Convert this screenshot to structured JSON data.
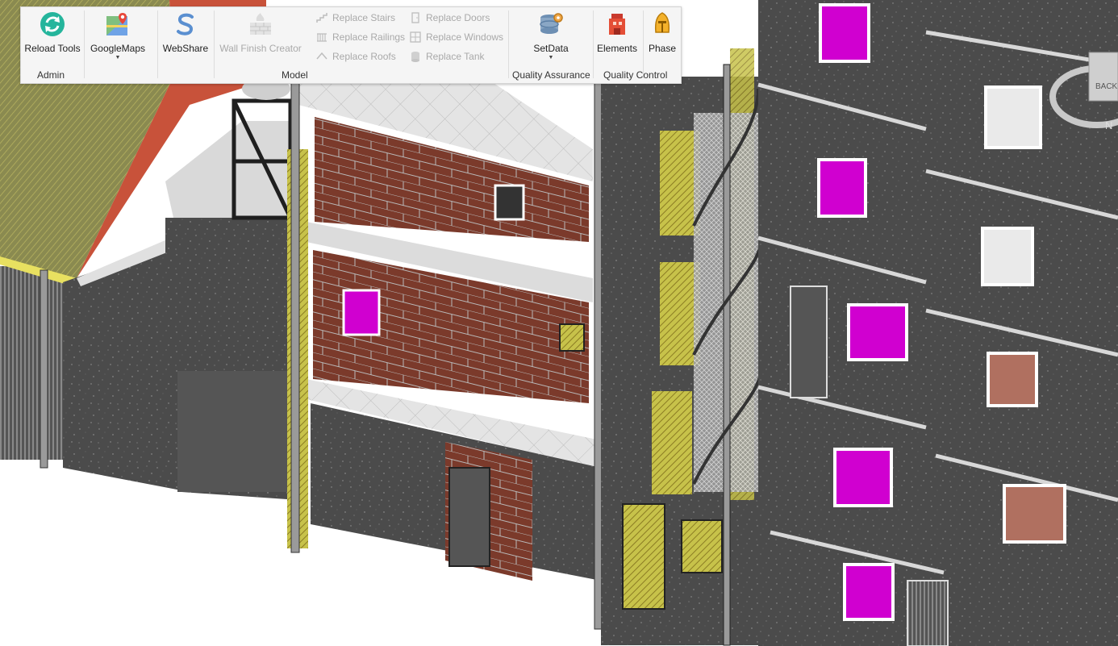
{
  "ribbon": {
    "admin": {
      "label": "Admin",
      "reload_tools": "Reload Tools"
    },
    "googlemaps": "GoogleMaps",
    "webshare": "WebShare",
    "model": {
      "label": "Model",
      "wall_finish_creator": "Wall Finish Creator",
      "replace_stairs": "Replace Stairs",
      "replace_railings": "Replace Railings",
      "replace_roofs": "Replace Roofs",
      "replace_doors": "Replace Doors",
      "replace_windows": "Replace Windows",
      "replace_tank": "Replace Tank"
    },
    "quality_assurance": {
      "label": "Quality Assurance",
      "setdata": "SetData"
    },
    "quality_control": {
      "label": "Quality Control",
      "elements": "Elements",
      "phase": "Phase"
    }
  },
  "viewcube": {
    "face": "BACK",
    "compass": "N"
  },
  "icons": {
    "reload": "reload-icon",
    "googlemaps": "map-pin-icon",
    "webshare": "webshare-s-icon",
    "wall_finish": "brick-wall-icon",
    "setdata": "database-gear-icon",
    "elements": "red-block-icon",
    "phase": "helmet-icon"
  },
  "colors": {
    "concrete": "#4a4a4a",
    "brick": "#7a3a2c",
    "window_magenta": "#d000d0",
    "highlight_yellow": "#e8e060",
    "ribbon_bg": "#f5f5f5",
    "ribbon_text": "#222222",
    "disabled_text": "#a9a9a9"
  }
}
